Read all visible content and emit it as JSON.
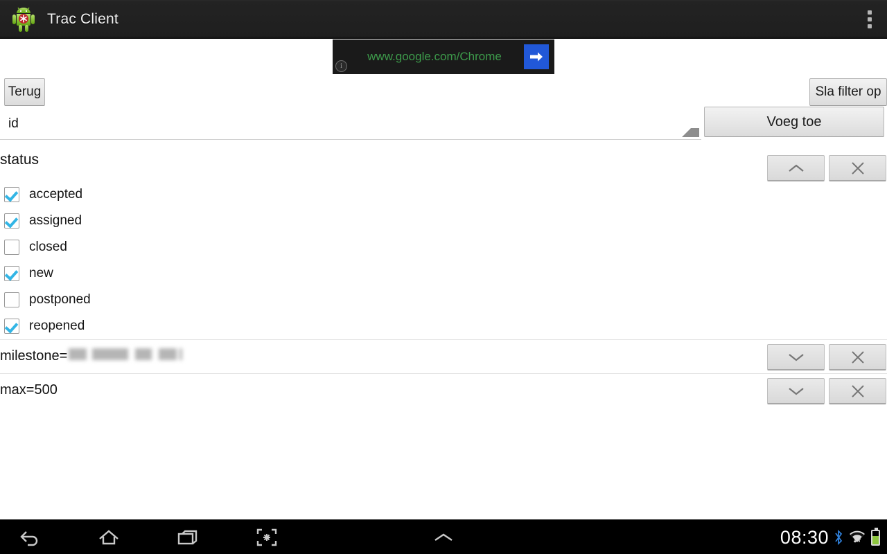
{
  "appbar": {
    "title": "Trac Client",
    "app_icon": "android-robot-icon",
    "overflow_icon": "overflow-menu-icon"
  },
  "ad": {
    "url": "www.google.com/Chrome",
    "cta_icon": "arrow-right-icon",
    "info_icon": "info-icon",
    "info_glyph": "i",
    "background_color": "#1a1a1a",
    "url_color": "#3d9b4b",
    "cta_color": "#2158d8"
  },
  "toolbar": {
    "back_label": "Terug",
    "save_filter_label": "Sla filter op"
  },
  "field_selector": {
    "selected": "id",
    "add_label": "Voeg toe",
    "dropdown_icon": "spinner-triangle-icon"
  },
  "filters": [
    {
      "name": "status",
      "expanded": true,
      "collapse_icon": "chevron-up-icon",
      "remove_icon": "close-icon",
      "options": [
        {
          "label": "accepted",
          "checked": true
        },
        {
          "label": "assigned",
          "checked": true
        },
        {
          "label": "closed",
          "checked": false
        },
        {
          "label": "new",
          "checked": true
        },
        {
          "label": "postponed",
          "checked": false
        },
        {
          "label": "reopened",
          "checked": true
        }
      ]
    },
    {
      "name": "milestone",
      "expanded": false,
      "label": "milestone=",
      "value_redacted": true,
      "expand_icon": "chevron-down-icon",
      "remove_icon": "close-icon"
    },
    {
      "name": "max",
      "expanded": false,
      "label": "max=500",
      "value_redacted": false,
      "expand_icon": "chevron-down-icon",
      "remove_icon": "close-icon"
    }
  ],
  "navbar": {
    "back_icon": "back-icon",
    "home_icon": "home-icon",
    "recents_icon": "recent-apps-icon",
    "screenshot_icon": "screenshot-icon",
    "expand_icon": "chevron-up-icon"
  },
  "statusbar": {
    "time": "08:30",
    "bluetooth_icon": "bluetooth-icon",
    "wifi_icon": "wifi-icon",
    "battery_icon": "battery-icon",
    "bluetooth_color": "#2f7fd8",
    "battery_color": "#8dc63f"
  },
  "checkbox_accent": "#33b5e5"
}
